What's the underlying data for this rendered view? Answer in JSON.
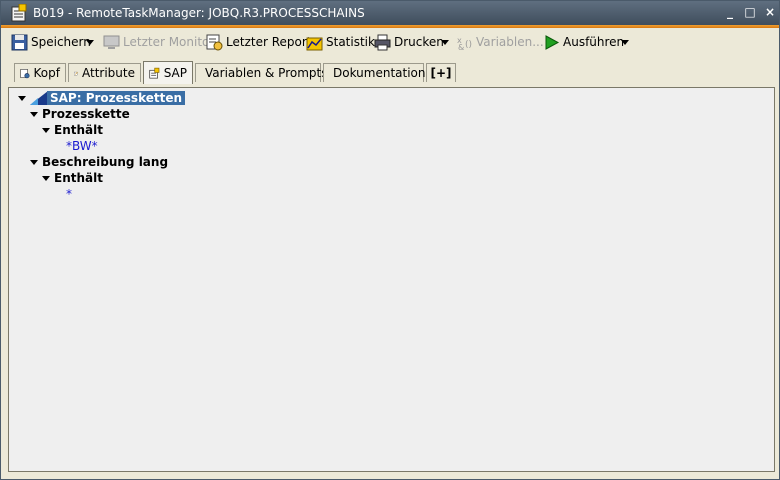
{
  "window": {
    "title": "B019 - RemoteTaskManager: JOBQ.R3.PROCESSCHAINS",
    "minimize": "_",
    "maximize": "□",
    "close": "×"
  },
  "toolbar": {
    "save": "Speichern",
    "last_monitor": "Letzter Monitor",
    "last_report": "Letzter Report",
    "statistics": "Statistik",
    "print": "Drucken",
    "variables": "Variablen...",
    "execute": "Ausführen"
  },
  "tabs": [
    {
      "label": "Kopf"
    },
    {
      "label": "Attribute"
    },
    {
      "label": "SAP"
    },
    {
      "label": "Variablen & Prompts"
    },
    {
      "label": "Dokumentation"
    },
    {
      "label": "[+]"
    }
  ],
  "active_tab": "SAP",
  "tree": {
    "root": "SAP: Prozessketten",
    "groups": [
      {
        "label": "Prozesskette",
        "child_label": "Enthält",
        "value": "*BW*"
      },
      {
        "label": "Beschreibung lang",
        "child_label": "Enthält",
        "value": "*"
      }
    ]
  },
  "colors": {
    "titlebar": "#4f5e6e",
    "accent_stripe": "#e8901e",
    "selection": "#3a6ea5",
    "value_text": "#1a1ad0"
  }
}
